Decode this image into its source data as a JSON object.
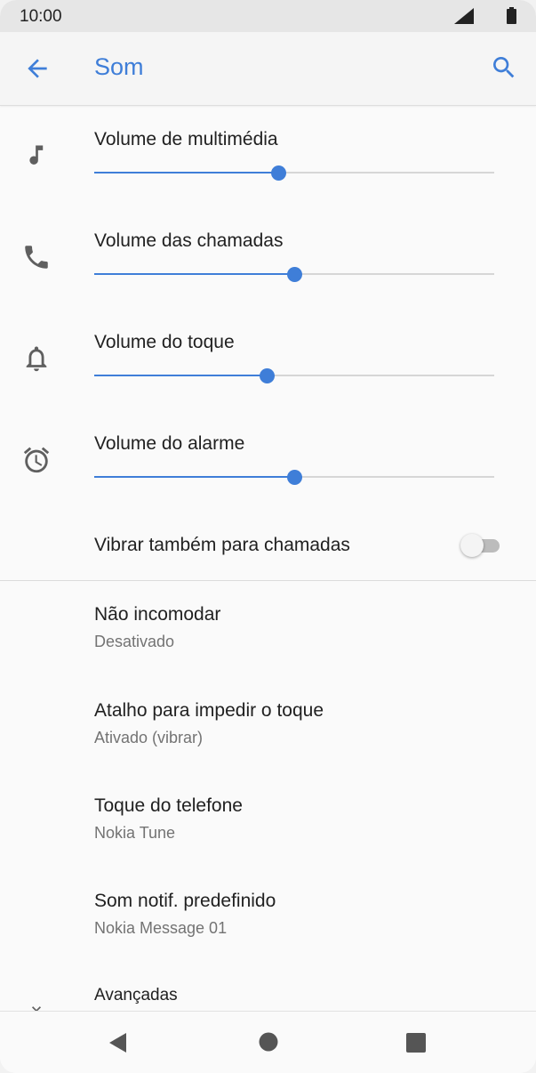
{
  "status_bar": {
    "time": "10:00"
  },
  "app_bar": {
    "title": "Som",
    "back_icon": "arrow-back-icon",
    "search_icon": "search-icon"
  },
  "volumes": [
    {
      "label": "Volume de multimédia",
      "icon": "music-note-icon",
      "level_percent": 46
    },
    {
      "label": "Volume das chamadas",
      "icon": "phone-icon",
      "level_percent": 50
    },
    {
      "label": "Volume do toque",
      "icon": "bell-icon",
      "level_percent": 43
    },
    {
      "label": "Volume do alarme",
      "icon": "alarm-clock-icon",
      "level_percent": 50
    }
  ],
  "vibrate": {
    "label": "Vibrar também para chamadas",
    "enabled": false
  },
  "prefs": [
    {
      "title": "Não incomodar",
      "summary": "Desativado"
    },
    {
      "title": "Atalho para impedir o toque",
      "summary": "Ativado (vibrar)"
    },
    {
      "title": "Toque do telefone",
      "summary": "Nokia Tune"
    },
    {
      "title": "Som notif. predefinido",
      "summary": "Nokia Message 01"
    }
  ],
  "advanced": {
    "label": "Avançadas",
    "icon": "chevron-down-icon"
  },
  "nav_bar": {
    "back_icon": "nav-back-icon",
    "home_icon": "nav-home-icon",
    "recents_icon": "nav-recents-icon"
  },
  "colors": {
    "accent": "#3f7ed8",
    "text_primary": "#212121",
    "text_secondary": "#737373",
    "background": "#fafafa"
  }
}
